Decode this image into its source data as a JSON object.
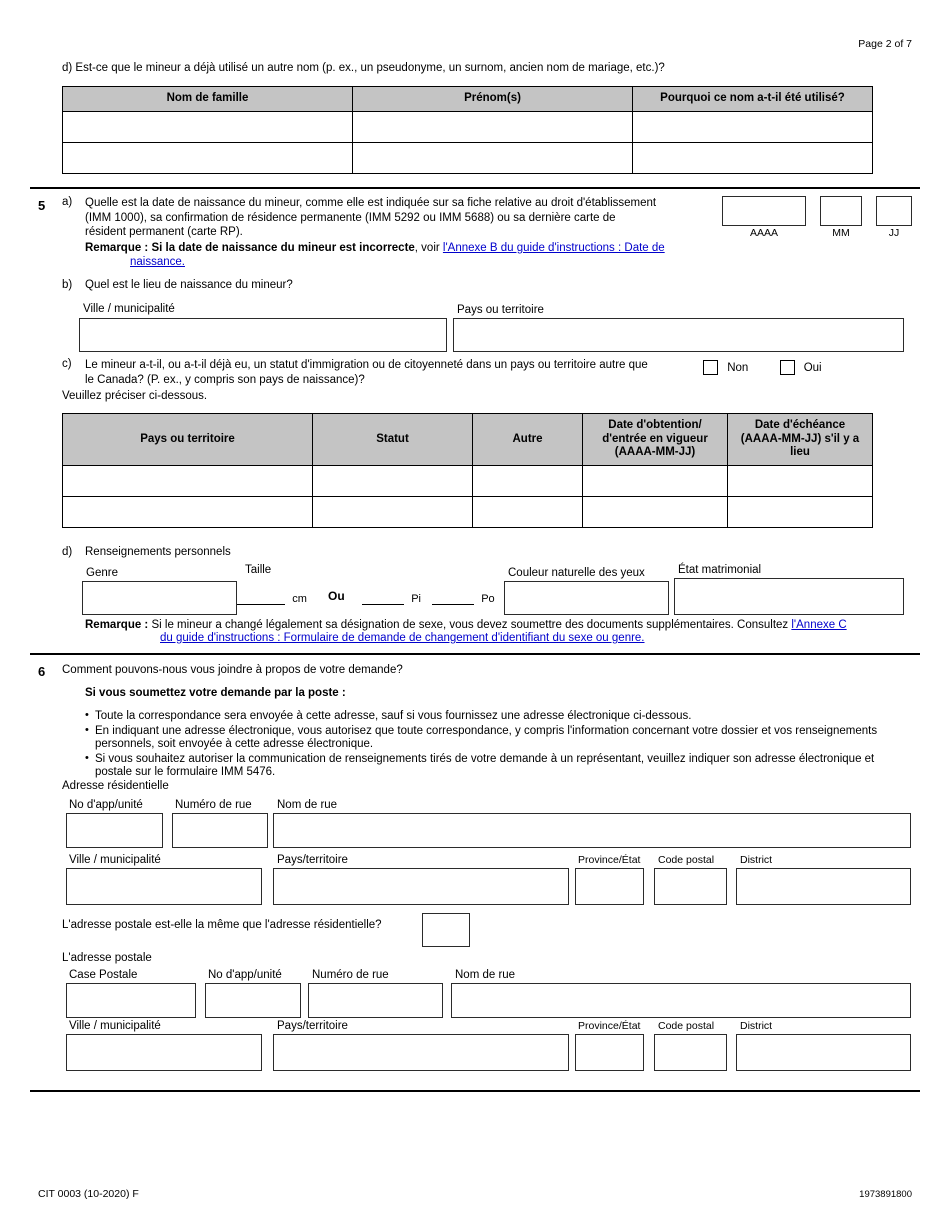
{
  "header": {
    "page_label": "Page 2 of 7"
  },
  "q4d": {
    "question": "d)  Est-ce que le mineur a déjà utilisé un autre nom (p. ex., un pseudonyme, un surnom, ancien nom de mariage, etc.)?",
    "table": {
      "columns": [
        "Nom de famille",
        "Prénom(s)",
        "Pourquoi ce nom a-t-il été utilisé?"
      ],
      "rows": [
        [
          "",
          "",
          ""
        ],
        [
          "",
          "",
          ""
        ]
      ]
    }
  },
  "q5": {
    "number": "5",
    "a": {
      "label": "a)",
      "line1": "Quelle est la date de naissance du mineur, comme elle est indiquée sur sa fiche relative au droit d'établissement",
      "line2": "(IMM 1000), sa confirmation de résidence permanente (IMM 5292 ou IMM 5688) ou sa dernière carte de",
      "line3": "résident permanent (carte RP).",
      "note_prefix": "Remarque : ",
      "note_bold": "Si la date de naissance du mineur est incorrecte",
      "note_mid": ", voir ",
      "note_link_1": "l'Annexe B du guide d'instructions : Date de",
      "note_link_2": "naissance.",
      "date_boxes": [
        {
          "name": "AAAA",
          "value": ""
        },
        {
          "name": "MM",
          "value": ""
        },
        {
          "name": "JJ",
          "value": ""
        }
      ]
    },
    "b": {
      "label": "b)",
      "question": "Quel est le lieu de naissance du mineur?",
      "city_label": "Ville / municipalité",
      "city_value": "",
      "country_label": "Pays ou territoire",
      "country_value": ""
    },
    "c": {
      "label": "c)",
      "line1": "Le mineur a-t-il, ou a-t-il déjà eu, un statut d'immigration ou de citoyenneté dans un pays ou territoire autre que",
      "line2": "le Canada? (P. ex., y compris son pays de naissance)?",
      "option_no": "Non",
      "option_yes": "Oui",
      "specify": "Veuillez préciser ci-dessous.",
      "table": {
        "columns": [
          "Pays ou territoire",
          "Statut",
          "Autre",
          "Date d'obtention/\nd'entrée en vigueur\n(AAAA-MM-JJ)",
          "Date d'échéance\n(AAAA-MM-JJ) s'il y a\nlieu"
        ],
        "col_4_lines": [
          "Date d'obtention/",
          "d'entrée en vigueur",
          "(AAAA-MM-JJ)"
        ],
        "col_5_lines": [
          "Date d'échéance",
          "(AAAA-MM-JJ) s'il y a",
          "lieu"
        ],
        "rows": [
          [
            "",
            "",
            "",
            "",
            ""
          ],
          [
            "",
            "",
            "",
            "",
            ""
          ]
        ]
      }
    },
    "d": {
      "label": "d)",
      "title": "Renseignements personnels",
      "gender_label": "Genre",
      "gender_value": "",
      "height_label": "Taille",
      "unit_cm": "cm",
      "or": "Ou",
      "unit_ft": "Pi",
      "unit_in": "Po",
      "height_cm_value": "",
      "height_ft_value": "",
      "height_in_value": "",
      "eye_label": "Couleur naturelle des yeux",
      "eye_value": "",
      "marital_label": "État matrimonial",
      "marital_value": "",
      "note_prefix": "Remarque : ",
      "note_text": "Si le mineur a changé légalement sa désignation de sexe, vous devez soumettre des documents supplémentaires. Consultez ",
      "note_link_1": "l'Annexe C",
      "note_link_2": "du guide d'instructions : Formulaire de demande de changement d'identifiant du sexe ou genre."
    }
  },
  "q6": {
    "number": "6",
    "question": "Comment pouvons-nous vous joindre à propos de votre demande?",
    "subheading": "Si vous soumettez votre demande par la poste :",
    "bullets": [
      "Toute la correspondance sera envoyée à cette adresse, sauf si vous fournissez une adresse électronique ci-dessous.",
      "En indiquant une adresse électronique, vous autorisez que toute correspondance, y compris l'information concernant votre dossier et vos renseignements personnels, soit envoyée à cette adresse électronique.",
      "Si vous souhaitez autoriser la communication de renseignements tirés de votre demande à un représentant, veuillez indiquer son adresse électronique et postale sur le formulaire IMM 5476."
    ],
    "residential": {
      "heading": "Adresse résidentielle",
      "apt_label": "No d'app/unité",
      "apt_value": "",
      "street_no_label": "Numéro de rue",
      "street_no_value": "",
      "street_name_label": "Nom de rue",
      "street_name_value": "",
      "city_label": "Ville / municipalité",
      "city_value": "",
      "country_label": "Pays/territoire",
      "country_value": "",
      "province_label": "Province/État",
      "province_value": "",
      "postal_label": "Code postal",
      "postal_value": "",
      "district_label": "District",
      "district_value": ""
    },
    "same_as_question": "L'adresse postale est-elle la même que l'adresse résidentielle?",
    "same_as_value": "",
    "postal": {
      "heading": "L'adresse postale",
      "pobox_label": "Case Postale",
      "pobox_value": "",
      "apt_label": "No d'app/unité",
      "apt_value": "",
      "street_no_label": "Numéro de rue",
      "street_no_value": "",
      "street_name_label": "Nom de rue",
      "street_name_value": "",
      "city_label": "Ville / municipalité",
      "city_value": "",
      "country_label": "Pays/territoire",
      "country_value": "",
      "province_label": "Province/État",
      "province_value": "",
      "postal_label": "Code postal",
      "postal_value": "",
      "district_label": "District",
      "district_value": ""
    }
  },
  "footer": {
    "form_code": "CIT 0003 (10-2020) F",
    "barcode_number": "1973891800"
  }
}
